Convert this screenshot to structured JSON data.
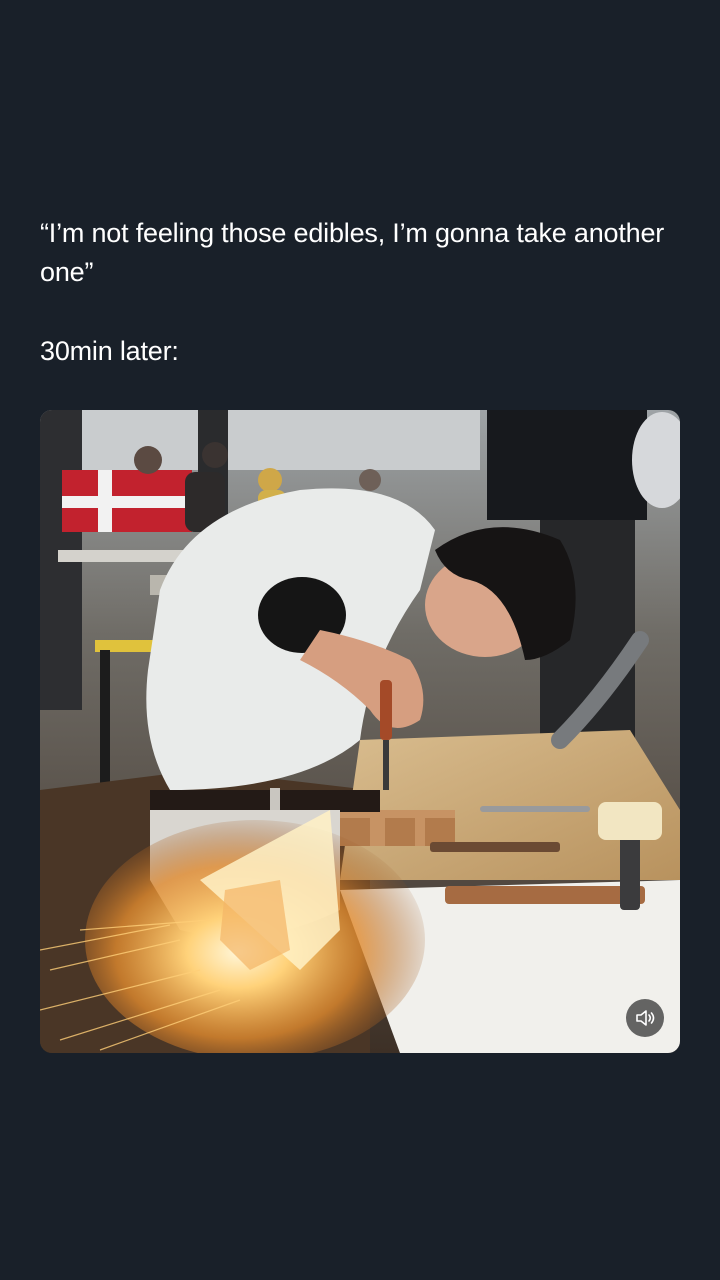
{
  "post": {
    "caption_line1": "“I’m not feeling those edibles, I’m gonna take another one”",
    "caption_line2": "30min later:"
  },
  "media": {
    "type": "video",
    "sound_icon": "speaker-muted-icon"
  }
}
